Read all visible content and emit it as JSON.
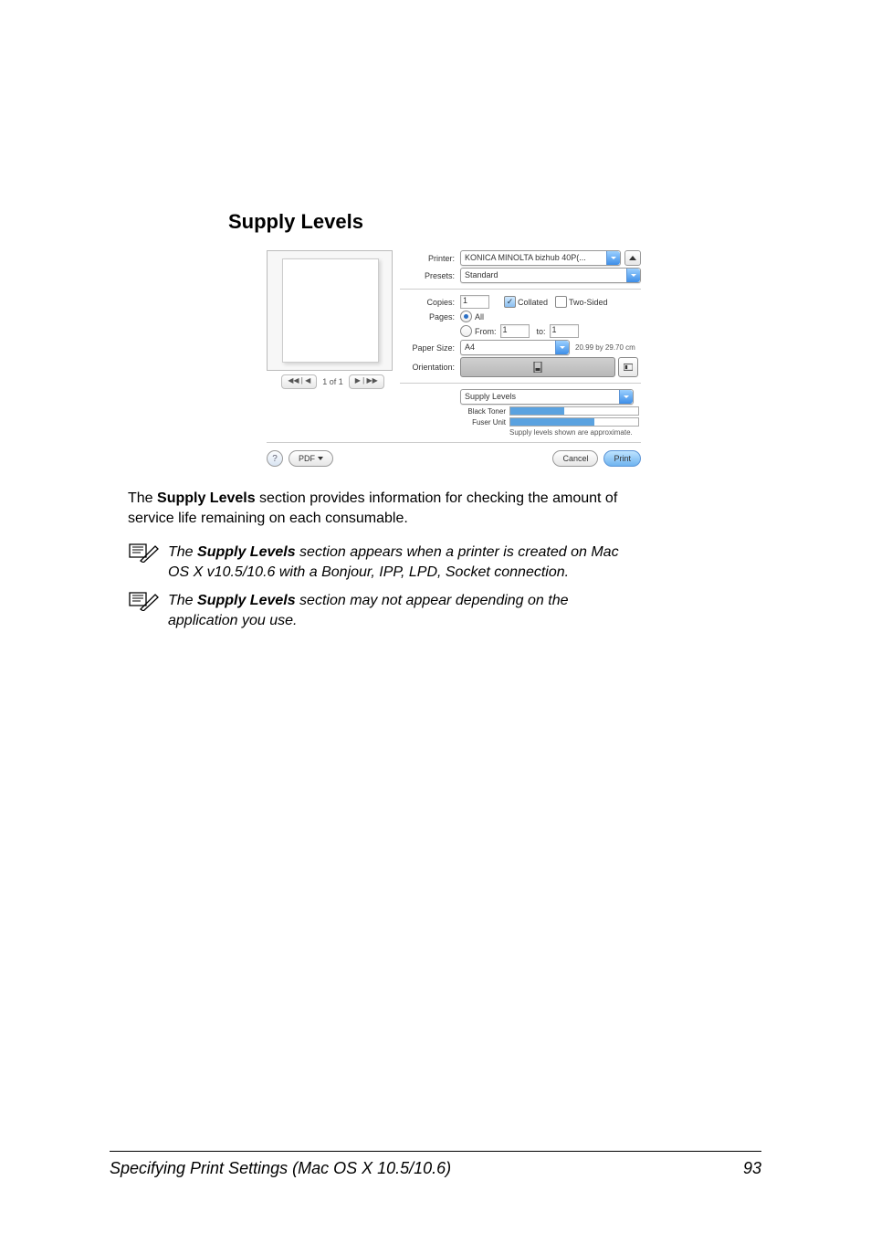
{
  "page": {
    "heading": "Supply Levels",
    "footer_section": "Specifying Print Settings (Mac OS X 10.5/10.6)",
    "footer_page": "93"
  },
  "dialog": {
    "printer_label": "Printer:",
    "printer_value": "KONICA MINOLTA bizhub 40P(...",
    "presets_label": "Presets:",
    "presets_value": "Standard",
    "copies_label": "Copies:",
    "copies_value": "1",
    "collated_label": "Collated",
    "twosided_label": "Two-Sided",
    "pages_label": "Pages:",
    "pages_all": "All",
    "pages_from": "From:",
    "pages_from_val": "1",
    "pages_to": "to:",
    "pages_to_val": "1",
    "papersize_label": "Paper Size:",
    "papersize_value": "A4",
    "papersize_dim": "20.99 by 29.70 cm",
    "orientation_label": "Orientation:",
    "section_value": "Supply Levels",
    "supplies": {
      "black_toner_label": "Black Toner",
      "black_toner_pct": 42,
      "fuser_label": "Fuser Unit",
      "fuser_pct": 66,
      "note": "Supply levels shown are approximate."
    },
    "preview_status": "1 of 1",
    "pdf_label": "PDF",
    "cancel_label": "Cancel",
    "print_label": "Print",
    "help_icon": "?"
  },
  "body": {
    "intro_pre": "The ",
    "intro_bold": "Supply Levels",
    "intro_post": " section provides information for checking the amount of service life remaining on each consumable.",
    "note1_pre": "The ",
    "note1_bold": "Supply Levels",
    "note1_post": " section appears when a printer is created on Mac OS X v10.5/10.6 with a Bonjour, IPP, LPD, Socket connection.",
    "note2_pre": "The ",
    "note2_bold": "Supply Levels",
    "note2_post": " section may not appear depending on the application you use."
  },
  "chart_data": {
    "type": "bar",
    "title": "Supply Levels",
    "categories": [
      "Black Toner",
      "Fuser Unit"
    ],
    "values": [
      42,
      66
    ],
    "ylim": [
      0,
      100
    ],
    "xlabel": "",
    "ylabel": ""
  }
}
